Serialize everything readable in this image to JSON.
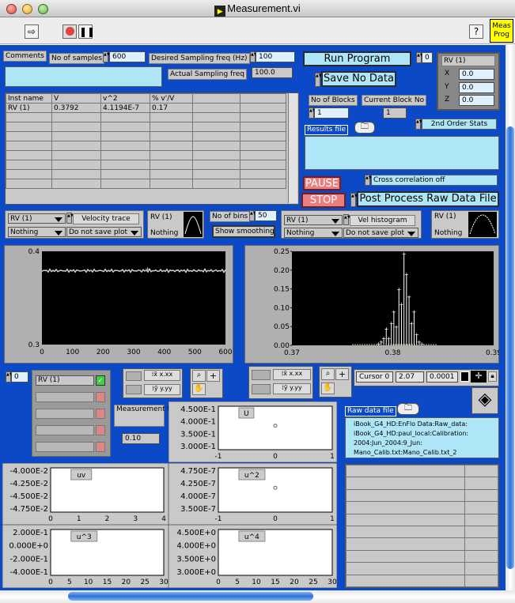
{
  "window": {
    "title": "Measurement.vi"
  },
  "toolbar": {
    "help": "?",
    "meas_prog": "Meas\nProg"
  },
  "controls": {
    "comments": "Comments",
    "no_samples_label": "No of samples",
    "no_samples": "600",
    "desired_freq_label": "Desired Sampling freq (Hz)",
    "desired_freq": "100",
    "actual_freq_label": "Actual Sampling freq",
    "actual_freq": "100.0",
    "run_program": "Run Program",
    "run_counter": "0",
    "save_no_data": "Save No Data",
    "no_blocks_label": "No of Blocks",
    "no_blocks": "1",
    "current_block_label": "Current Block No",
    "current_block": "1",
    "results_file": "Results file",
    "stats_mode": "2nd Order Stats",
    "pause": "PAUSE",
    "stop": "STOP",
    "cross_corr": "Cross correlation off",
    "post_process": "Post Process Raw Data File"
  },
  "probe": {
    "name": "RV (1)",
    "x": "0.0",
    "y": "0.0",
    "z": "0.0",
    "x_label": "X",
    "y_label": "Y",
    "z_label": "Z"
  },
  "table": {
    "headers": [
      "Inst name",
      "V",
      "v^2",
      "% v'/V",
      "",
      ""
    ],
    "row": [
      "RV (1)",
      "0.3792",
      "4.1194E-7",
      "0.17",
      "",
      ""
    ]
  },
  "velocity": {
    "probe": "RV (1)",
    "trace": "Velocity trace",
    "mode": "Nothing",
    "save": "Do not save plot",
    "mini_name": "RV (1)",
    "mini_mode": "Nothing"
  },
  "histogram": {
    "bins_label": "No of bins",
    "bins": "50",
    "smoothing": "Show smoothing",
    "probe": "RV (1)",
    "type": "Vel histogram",
    "mode": "Nothing",
    "save": "Do not save plot",
    "mini_name": "RV (1)",
    "mini_mode": "Nothing"
  },
  "cursor": {
    "name": "Cursor 0",
    "x": "2.07",
    "y": "0.0001"
  },
  "left_ctrl": {
    "index": "0",
    "probe": "RV (1)",
    "meas_time_label": "Measurement time (min)",
    "meas_time": "0.10"
  },
  "raw_data": {
    "label": "Raw data file",
    "path": "iBook_G4_HD:EnFlo Data:Raw_data:\niBook_G4_HD:paul_local:Calibration:\n2004:Jun_2004:9_Jun:\nMano_Calib.txt:Mano_Calib.txt_2"
  },
  "charts": {
    "velocity_trace": {
      "type": "line",
      "x": [
        0,
        600
      ],
      "ylim": [
        0.3,
        0.4
      ],
      "xticks": [
        "0",
        "100",
        "200",
        "300",
        "400",
        "500",
        "600"
      ],
      "yticks": [
        "0.4",
        "0.3"
      ],
      "mean": 0.3792
    },
    "histogram": {
      "type": "bar",
      "xlim": [
        0.37,
        0.39
      ],
      "ylim": [
        0,
        0.25
      ],
      "xticks": [
        "0.37",
        "0.38",
        "0.39"
      ],
      "yticks": [
        "0.25",
        "0.20",
        "0.15",
        "0.10",
        "0.05",
        "0.00"
      ]
    },
    "U": {
      "title": "U",
      "yticks": [
        "4.500E-1",
        "4.000E-1",
        "3.500E-1",
        "3.000E-1"
      ],
      "xticks": [
        "-1",
        "0",
        "1"
      ],
      "point": [
        0,
        0.38
      ]
    },
    "uv": {
      "title": "uv",
      "yticks": [
        "-4.000E-2",
        "-4.250E-2",
        "-4.500E-2",
        "-4.750E-2"
      ],
      "xticks": [
        "0",
        "1",
        "2",
        "3",
        "4"
      ]
    },
    "u2": {
      "title": "u^2",
      "yticks": [
        "4.750E-7",
        "4.250E-7",
        "4.000E-7",
        "3.500E-7"
      ],
      "xticks": [
        "-1",
        "0",
        "1"
      ],
      "point": [
        0,
        4.12e-07
      ]
    },
    "u3": {
      "title": "u^3",
      "yticks": [
        "2.000E-1",
        "0.000E+0",
        "-2.000E-1",
        "-4.000E-1"
      ],
      "xticks": [
        "0",
        "5",
        "10",
        "15",
        "20",
        "25",
        "30"
      ]
    },
    "u4": {
      "title": "u^4",
      "yticks": [
        "4.500E+0",
        "4.000E+0",
        "3.500E+0",
        "3.000E+0"
      ],
      "xticks": [
        "0",
        "5",
        "10",
        "15",
        "20",
        "25",
        "30"
      ]
    }
  },
  "colors": {
    "panel": "#0c49c6",
    "cyan": "#aee6f7",
    "trace": "#c8c8c8"
  }
}
